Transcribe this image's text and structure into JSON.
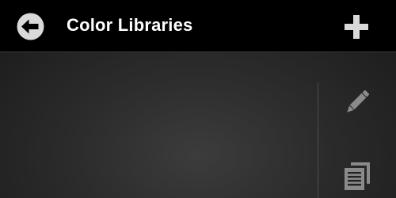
{
  "header": {
    "title": "Color Libraries",
    "back_icon": "back-arrow-circle-icon",
    "add_icon": "plus-icon"
  },
  "sidebar": {
    "tools": [
      {
        "name": "edit-button",
        "icon": "pencil-icon"
      },
      {
        "name": "duplicate-button",
        "icon": "copy-document-icon"
      }
    ]
  },
  "colors": {
    "header_bg": "#000000",
    "title_text": "#ffffff",
    "content_bg": "#2c2c2c",
    "icon_header": "#d9d9d9",
    "icon_side": "#8a8a8a"
  }
}
